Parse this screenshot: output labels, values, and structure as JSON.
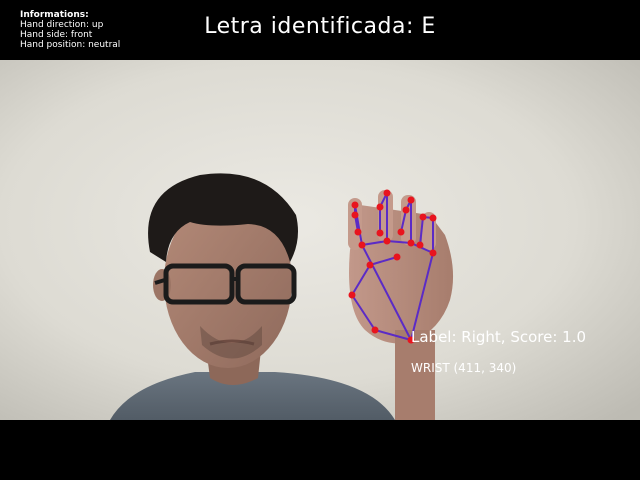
{
  "info": {
    "title": "Informations:",
    "lines": [
      "Hand direction: up",
      "Hand side: front",
      "Hand position: neutral"
    ]
  },
  "header": {
    "letter_title": "Letra identificada: E"
  },
  "overlay": {
    "label_text": "Label: Right, Score: 1.0",
    "wrist_text": "WRIST (411, 340)",
    "connection_color": "#5b2bc6",
    "landmark_color": "#e8141e"
  }
}
